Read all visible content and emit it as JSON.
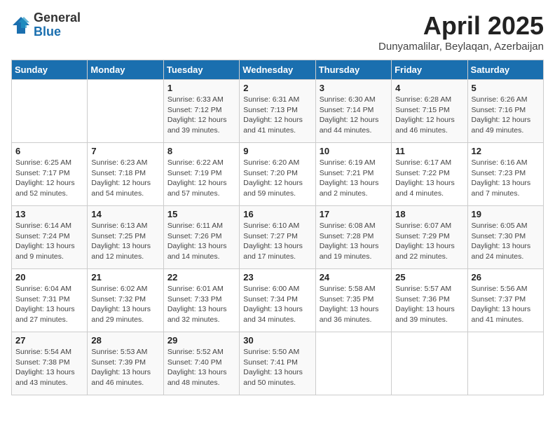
{
  "logo": {
    "general": "General",
    "blue": "Blue"
  },
  "title": "April 2025",
  "subtitle": "Dunyamalilar, Beylaqan, Azerbaijan",
  "days_header": [
    "Sunday",
    "Monday",
    "Tuesday",
    "Wednesday",
    "Thursday",
    "Friday",
    "Saturday"
  ],
  "weeks": [
    [
      {
        "day": "",
        "info": ""
      },
      {
        "day": "",
        "info": ""
      },
      {
        "day": "1",
        "info": "Sunrise: 6:33 AM\nSunset: 7:12 PM\nDaylight: 12 hours and 39 minutes."
      },
      {
        "day": "2",
        "info": "Sunrise: 6:31 AM\nSunset: 7:13 PM\nDaylight: 12 hours and 41 minutes."
      },
      {
        "day": "3",
        "info": "Sunrise: 6:30 AM\nSunset: 7:14 PM\nDaylight: 12 hours and 44 minutes."
      },
      {
        "day": "4",
        "info": "Sunrise: 6:28 AM\nSunset: 7:15 PM\nDaylight: 12 hours and 46 minutes."
      },
      {
        "day": "5",
        "info": "Sunrise: 6:26 AM\nSunset: 7:16 PM\nDaylight: 12 hours and 49 minutes."
      }
    ],
    [
      {
        "day": "6",
        "info": "Sunrise: 6:25 AM\nSunset: 7:17 PM\nDaylight: 12 hours and 52 minutes."
      },
      {
        "day": "7",
        "info": "Sunrise: 6:23 AM\nSunset: 7:18 PM\nDaylight: 12 hours and 54 minutes."
      },
      {
        "day": "8",
        "info": "Sunrise: 6:22 AM\nSunset: 7:19 PM\nDaylight: 12 hours and 57 minutes."
      },
      {
        "day": "9",
        "info": "Sunrise: 6:20 AM\nSunset: 7:20 PM\nDaylight: 12 hours and 59 minutes."
      },
      {
        "day": "10",
        "info": "Sunrise: 6:19 AM\nSunset: 7:21 PM\nDaylight: 13 hours and 2 minutes."
      },
      {
        "day": "11",
        "info": "Sunrise: 6:17 AM\nSunset: 7:22 PM\nDaylight: 13 hours and 4 minutes."
      },
      {
        "day": "12",
        "info": "Sunrise: 6:16 AM\nSunset: 7:23 PM\nDaylight: 13 hours and 7 minutes."
      }
    ],
    [
      {
        "day": "13",
        "info": "Sunrise: 6:14 AM\nSunset: 7:24 PM\nDaylight: 13 hours and 9 minutes."
      },
      {
        "day": "14",
        "info": "Sunrise: 6:13 AM\nSunset: 7:25 PM\nDaylight: 13 hours and 12 minutes."
      },
      {
        "day": "15",
        "info": "Sunrise: 6:11 AM\nSunset: 7:26 PM\nDaylight: 13 hours and 14 minutes."
      },
      {
        "day": "16",
        "info": "Sunrise: 6:10 AM\nSunset: 7:27 PM\nDaylight: 13 hours and 17 minutes."
      },
      {
        "day": "17",
        "info": "Sunrise: 6:08 AM\nSunset: 7:28 PM\nDaylight: 13 hours and 19 minutes."
      },
      {
        "day": "18",
        "info": "Sunrise: 6:07 AM\nSunset: 7:29 PM\nDaylight: 13 hours and 22 minutes."
      },
      {
        "day": "19",
        "info": "Sunrise: 6:05 AM\nSunset: 7:30 PM\nDaylight: 13 hours and 24 minutes."
      }
    ],
    [
      {
        "day": "20",
        "info": "Sunrise: 6:04 AM\nSunset: 7:31 PM\nDaylight: 13 hours and 27 minutes."
      },
      {
        "day": "21",
        "info": "Sunrise: 6:02 AM\nSunset: 7:32 PM\nDaylight: 13 hours and 29 minutes."
      },
      {
        "day": "22",
        "info": "Sunrise: 6:01 AM\nSunset: 7:33 PM\nDaylight: 13 hours and 32 minutes."
      },
      {
        "day": "23",
        "info": "Sunrise: 6:00 AM\nSunset: 7:34 PM\nDaylight: 13 hours and 34 minutes."
      },
      {
        "day": "24",
        "info": "Sunrise: 5:58 AM\nSunset: 7:35 PM\nDaylight: 13 hours and 36 minutes."
      },
      {
        "day": "25",
        "info": "Sunrise: 5:57 AM\nSunset: 7:36 PM\nDaylight: 13 hours and 39 minutes."
      },
      {
        "day": "26",
        "info": "Sunrise: 5:56 AM\nSunset: 7:37 PM\nDaylight: 13 hours and 41 minutes."
      }
    ],
    [
      {
        "day": "27",
        "info": "Sunrise: 5:54 AM\nSunset: 7:38 PM\nDaylight: 13 hours and 43 minutes."
      },
      {
        "day": "28",
        "info": "Sunrise: 5:53 AM\nSunset: 7:39 PM\nDaylight: 13 hours and 46 minutes."
      },
      {
        "day": "29",
        "info": "Sunrise: 5:52 AM\nSunset: 7:40 PM\nDaylight: 13 hours and 48 minutes."
      },
      {
        "day": "30",
        "info": "Sunrise: 5:50 AM\nSunset: 7:41 PM\nDaylight: 13 hours and 50 minutes."
      },
      {
        "day": "",
        "info": ""
      },
      {
        "day": "",
        "info": ""
      },
      {
        "day": "",
        "info": ""
      }
    ]
  ]
}
